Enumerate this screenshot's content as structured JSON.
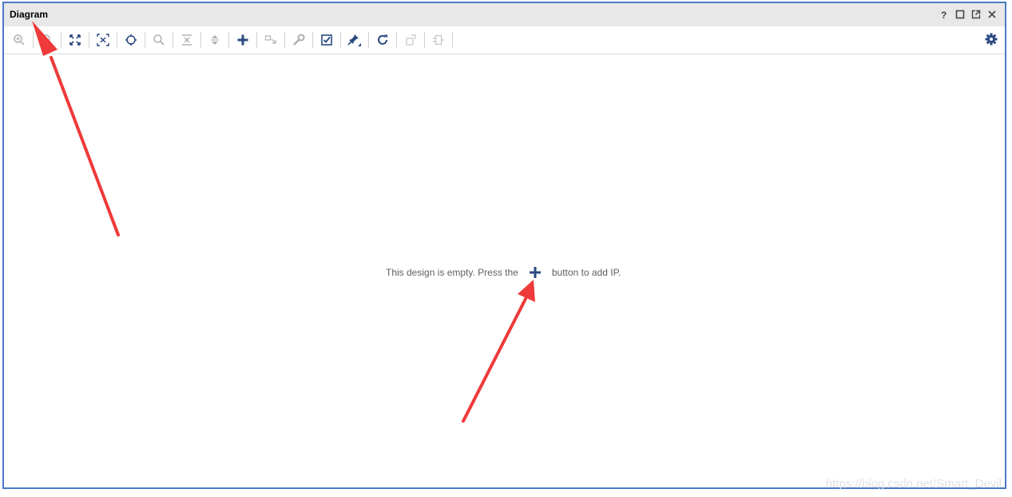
{
  "window": {
    "title": "Diagram",
    "controls": [
      "help",
      "maximize",
      "float",
      "close"
    ]
  },
  "toolbar": {
    "icons": [
      "zoom-in",
      "zoom-out",
      "zoom-fit",
      "auto-fit-selection",
      "center-view",
      "search",
      "collapse-all",
      "expand-all",
      "add-ip",
      "make-external",
      "properties",
      "validate-design",
      "pin",
      "regenerate-layout",
      "unknown-1",
      "unknown-2"
    ],
    "accent": "#2b4a80"
  },
  "canvas": {
    "message_before": "This design is empty. Press the",
    "message_after": "button to add IP."
  },
  "watermark": "https://blog.csdn.net/Smart_Devil",
  "annotations": {
    "arrow_color": "#ee3a3a"
  }
}
